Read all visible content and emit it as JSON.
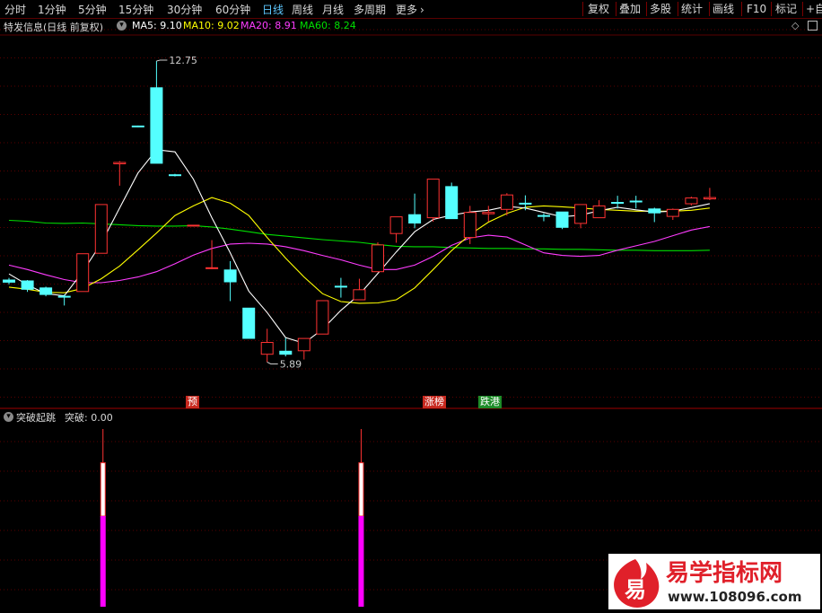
{
  "toolbar": {
    "tabs": [
      "分时",
      "1分钟",
      "5分钟",
      "15分钟",
      "30分钟",
      "60分钟",
      "日线",
      "周线",
      "月线",
      "多周期",
      "更多"
    ],
    "active_tab": "日线",
    "more_chevron": "chevron-right-icon",
    "right_buttons": [
      "复权",
      "叠加",
      "多股",
      "统计",
      "画线",
      "F10",
      "标记",
      "+自"
    ]
  },
  "main_info": {
    "title": "特发信息(日线 前复权)",
    "dropdown_icon": "chevron-down-circle-icon",
    "ma5": "MA5: 9.10",
    "ma10": "MA10: 9.02",
    "ma20": "MA20: 8.91",
    "ma60": "MA60: 8.24",
    "diamond_icon": "diamond-icon",
    "square_icon": "square-icon"
  },
  "price_labels": {
    "high": "12.75",
    "low": "5.89"
  },
  "badges": [
    {
      "text": "预",
      "bg": "#c8281e",
      "fg": "#ffffff"
    },
    {
      "text": "涨榜",
      "bg": "#c8281e",
      "fg": "#ffffff"
    },
    {
      "text": "跌港",
      "bg": "#1e8c28",
      "fg": "#ffffff"
    }
  ],
  "sub_info": {
    "dropdown_icon": "chevron-down-circle-icon",
    "title": "突破起跳",
    "value": "突破: 0.00"
  },
  "watermark": {
    "glyph": "易",
    "title": "易学指标网",
    "url": "www.108096.com"
  },
  "colors": {
    "up": "#ff3232",
    "down": "#54ffff",
    "ma5": "#ffffff",
    "ma10": "#ffff00",
    "ma20": "#ff3cff",
    "ma60": "#00e000",
    "grid": "#5a0000",
    "signal": "#ff00ff"
  },
  "chart_data": {
    "type": "candlestick",
    "candles": [
      {
        "o": 7.76,
        "c": 7.71,
        "h": 7.81,
        "l": 7.66
      },
      {
        "o": 7.74,
        "c": 7.55,
        "h": 7.76,
        "l": 7.49
      },
      {
        "o": 7.58,
        "c": 7.43,
        "h": 7.61,
        "l": 7.39
      },
      {
        "o": 7.39,
        "c": 7.37,
        "h": 7.43,
        "l": 7.18
      },
      {
        "o": 7.5,
        "c": 8.36,
        "h": 8.36,
        "l": 7.5
      },
      {
        "o": 8.37,
        "c": 9.48,
        "h": 9.48,
        "l": 8.37
      },
      {
        "o": 10.41,
        "c": 10.44,
        "h": 10.47,
        "l": 9.91
      },
      {
        "o": 11.27,
        "c": 11.25,
        "h": 11.28,
        "l": 11.24
      },
      {
        "o": 12.14,
        "c": 10.42,
        "h": 12.75,
        "l": 10.42
      },
      {
        "o": 10.16,
        "c": 10.14,
        "h": 10.18,
        "l": 10.12
      },
      {
        "o": 8.99,
        "c": 9.01,
        "h": 9.01,
        "l": 8.98
      },
      {
        "o": 8.03,
        "c": 8.04,
        "h": 8.67,
        "l": 8.01
      },
      {
        "o": 7.99,
        "c": 7.72,
        "h": 8.19,
        "l": 7.28
      },
      {
        "o": 7.12,
        "c": 6.43,
        "h": 7.12,
        "l": 6.43
      },
      {
        "o": 6.07,
        "c": 6.34,
        "h": 6.65,
        "l": 5.89
      },
      {
        "o": 6.14,
        "c": 6.07,
        "h": 6.44,
        "l": 6.02
      },
      {
        "o": 6.15,
        "c": 6.43,
        "h": 6.43,
        "l": 5.95
      },
      {
        "o": 6.53,
        "c": 7.29,
        "h": 7.29,
        "l": 6.53
      },
      {
        "o": 7.62,
        "c": 7.6,
        "h": 7.81,
        "l": 7.36
      },
      {
        "o": 7.31,
        "c": 7.54,
        "h": 7.79,
        "l": 7.31
      },
      {
        "o": 7.95,
        "c": 8.56,
        "h": 8.62,
        "l": 7.95
      },
      {
        "o": 8.82,
        "c": 9.2,
        "h": 9.2,
        "l": 8.61
      },
      {
        "o": 9.25,
        "c": 9.06,
        "h": 9.73,
        "l": 8.94
      },
      {
        "o": 9.18,
        "c": 10.06,
        "h": 10.06,
        "l": 9.09
      },
      {
        "o": 9.89,
        "c": 9.16,
        "h": 9.98,
        "l": 9.16
      },
      {
        "o": 8.73,
        "c": 9.3,
        "h": 9.45,
        "l": 8.58
      },
      {
        "o": 9.27,
        "c": 9.3,
        "h": 9.45,
        "l": 9.09
      },
      {
        "o": 9.37,
        "c": 9.7,
        "h": 9.74,
        "l": 9.23
      },
      {
        "o": 9.51,
        "c": 9.49,
        "h": 9.69,
        "l": 9.35
      },
      {
        "o": 9.23,
        "c": 9.21,
        "h": 9.28,
        "l": 9.1
      },
      {
        "o": 9.31,
        "c": 8.96,
        "h": 9.31,
        "l": 8.92
      },
      {
        "o": 9.05,
        "c": 9.48,
        "h": 9.48,
        "l": 8.94
      },
      {
        "o": 9.18,
        "c": 9.45,
        "h": 9.58,
        "l": 9.18
      },
      {
        "o": 9.53,
        "c": 9.51,
        "h": 9.68,
        "l": 9.39
      },
      {
        "o": 9.56,
        "c": 9.55,
        "h": 9.68,
        "l": 9.39
      },
      {
        "o": 9.38,
        "c": 9.29,
        "h": 9.41,
        "l": 9.08
      },
      {
        "o": 9.21,
        "c": 9.37,
        "h": 9.39,
        "l": 9.13
      },
      {
        "o": 9.5,
        "c": 9.63,
        "h": 9.66,
        "l": 9.46
      },
      {
        "o": 9.61,
        "c": 9.64,
        "h": 9.86,
        "l": 9.58
      }
    ],
    "ma5": [
      7.9,
      7.65,
      7.45,
      7.4,
      7.95,
      8.6,
      9.4,
      10.2,
      10.73,
      10.68,
      10.06,
      9.18,
      8.38,
      7.51,
      7.02,
      6.45,
      6.32,
      6.64,
      7.07,
      7.43,
      7.91,
      8.4,
      8.86,
      9.14,
      9.24,
      9.31,
      9.35,
      9.44,
      9.4,
      9.3,
      9.2,
      9.24,
      9.34,
      9.42,
      9.36,
      9.31,
      9.33,
      9.41,
      9.5
    ],
    "ma10": [
      7.6,
      7.55,
      7.48,
      7.47,
      7.57,
      7.79,
      8.08,
      8.45,
      8.83,
      9.23,
      9.45,
      9.64,
      9.51,
      9.23,
      8.73,
      8.26,
      7.83,
      7.45,
      7.27,
      7.23,
      7.24,
      7.31,
      7.58,
      8.0,
      8.43,
      8.8,
      9.08,
      9.28,
      9.42,
      9.45,
      9.43,
      9.4,
      9.37,
      9.35,
      9.33,
      9.33,
      9.33,
      9.35,
      9.4
    ],
    "ma20": [
      8.1,
      8.0,
      7.88,
      7.77,
      7.7,
      7.7,
      7.75,
      7.83,
      7.95,
      8.13,
      8.33,
      8.48,
      8.58,
      8.6,
      8.58,
      8.52,
      8.43,
      8.32,
      8.22,
      8.1,
      8.0,
      8.0,
      8.1,
      8.3,
      8.55,
      8.72,
      8.78,
      8.74,
      8.56,
      8.38,
      8.32,
      8.3,
      8.32,
      8.44,
      8.54,
      8.64,
      8.77,
      8.9,
      8.98
    ],
    "ma60": [
      9.12,
      9.1,
      9.06,
      9.05,
      9.06,
      9.04,
      9.02,
      9.0,
      8.99,
      8.99,
      9.0,
      8.97,
      8.92,
      8.86,
      8.8,
      8.76,
      8.72,
      8.68,
      8.65,
      8.62,
      8.57,
      8.53,
      8.52,
      8.52,
      8.5,
      8.49,
      8.48,
      8.48,
      8.47,
      8.47,
      8.46,
      8.46,
      8.45,
      8.44,
      8.44,
      8.43,
      8.43,
      8.43,
      8.44
    ],
    "signals": [
      {
        "index": 5,
        "value": 1
      },
      {
        "index": 19,
        "value": 1
      }
    ],
    "badge_positions": [
      {
        "badge": 0,
        "index": 10
      },
      {
        "badge": 1,
        "index": 23
      },
      {
        "badge": 2,
        "index": 26
      }
    ]
  }
}
